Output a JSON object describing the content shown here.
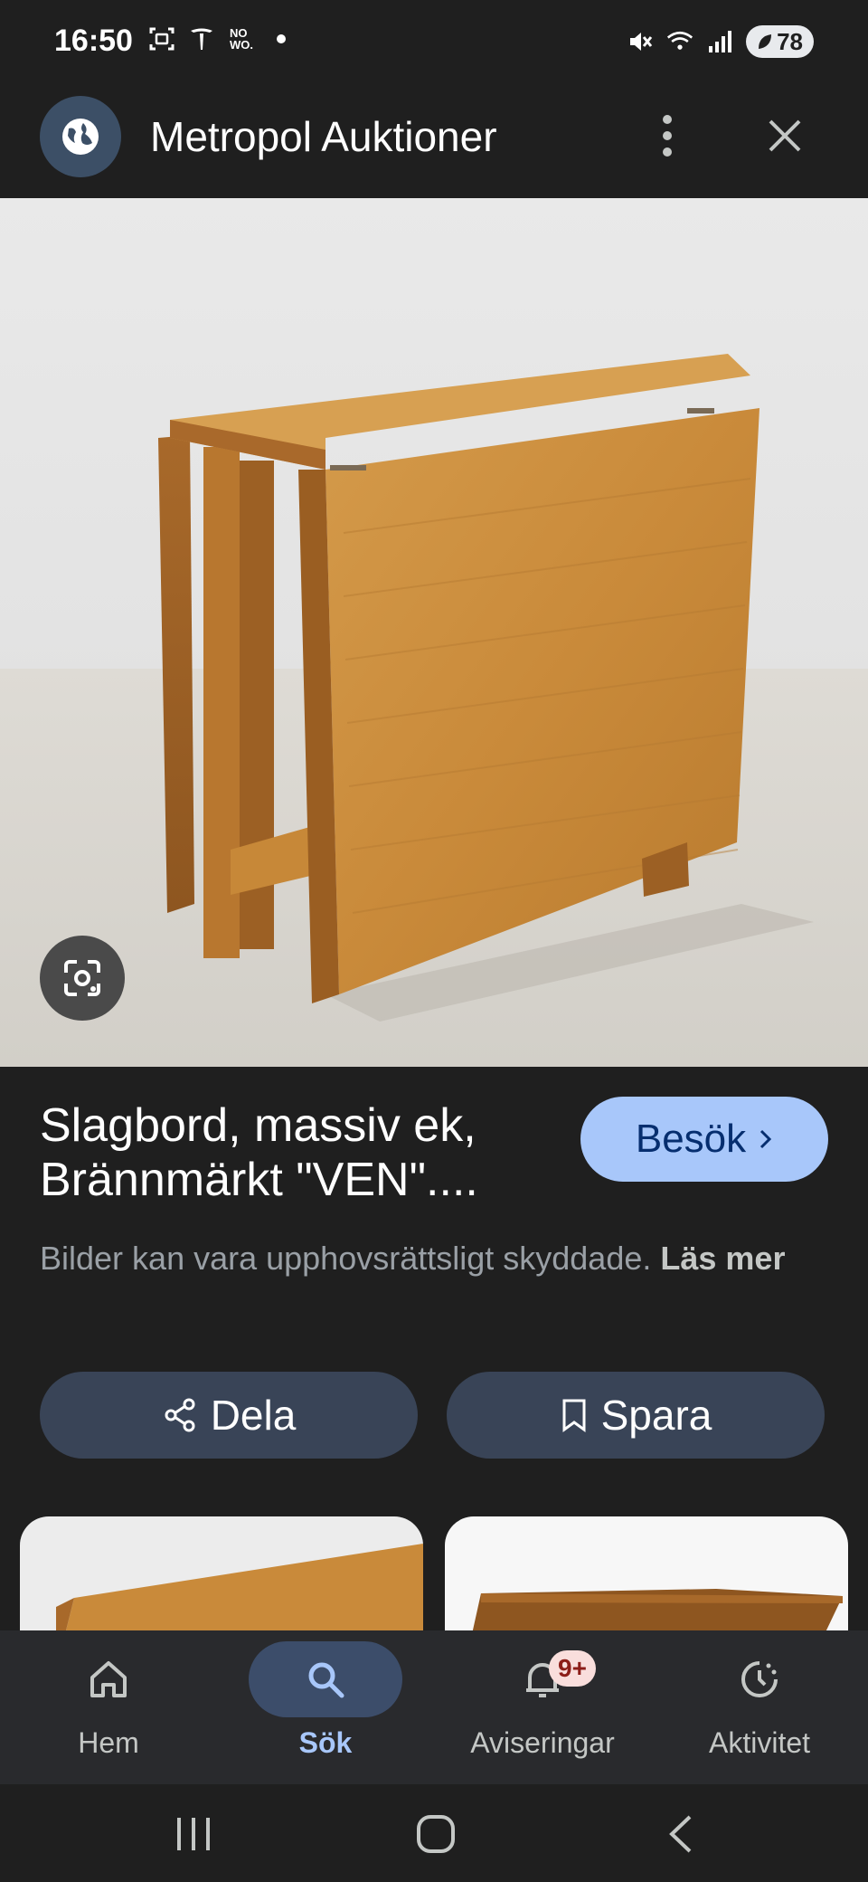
{
  "status_bar": {
    "time": "16:50",
    "left_icons": [
      "screenshot-icon",
      "tesla-icon",
      "no-wo-icon",
      "dot-icon"
    ],
    "no_wo_text": "NO\nWO.",
    "right_icons": [
      "mute-icon",
      "wifi-icon",
      "signal-icon"
    ],
    "battery": "78"
  },
  "header": {
    "site_title": "Metropol Auktioner",
    "site_icon": "globe-icon"
  },
  "result": {
    "title": "Slagbord, massiv ek, Brännmärkt \"VEN\"....",
    "visit_label": "Besök",
    "copyright_text": "Bilder kan vara upphovsrättsligt skyddade. ",
    "read_more": "Läs mer",
    "share_label": "Dela",
    "save_label": "Spara"
  },
  "bottom_nav": {
    "items": [
      {
        "label": "Hem",
        "icon": "home-icon",
        "active": false
      },
      {
        "label": "Sök",
        "icon": "search-icon",
        "active": true
      },
      {
        "label": "Aviseringar",
        "icon": "bell-icon",
        "active": false,
        "badge": "9+"
      },
      {
        "label": "Aktivitet",
        "icon": "activity-icon",
        "active": false
      }
    ]
  },
  "colors": {
    "background": "#1f1f1f",
    "accent": "#a8c7fa",
    "pill": "#394457",
    "nav_bg": "#292a2d",
    "wood": "#c98a3a"
  }
}
